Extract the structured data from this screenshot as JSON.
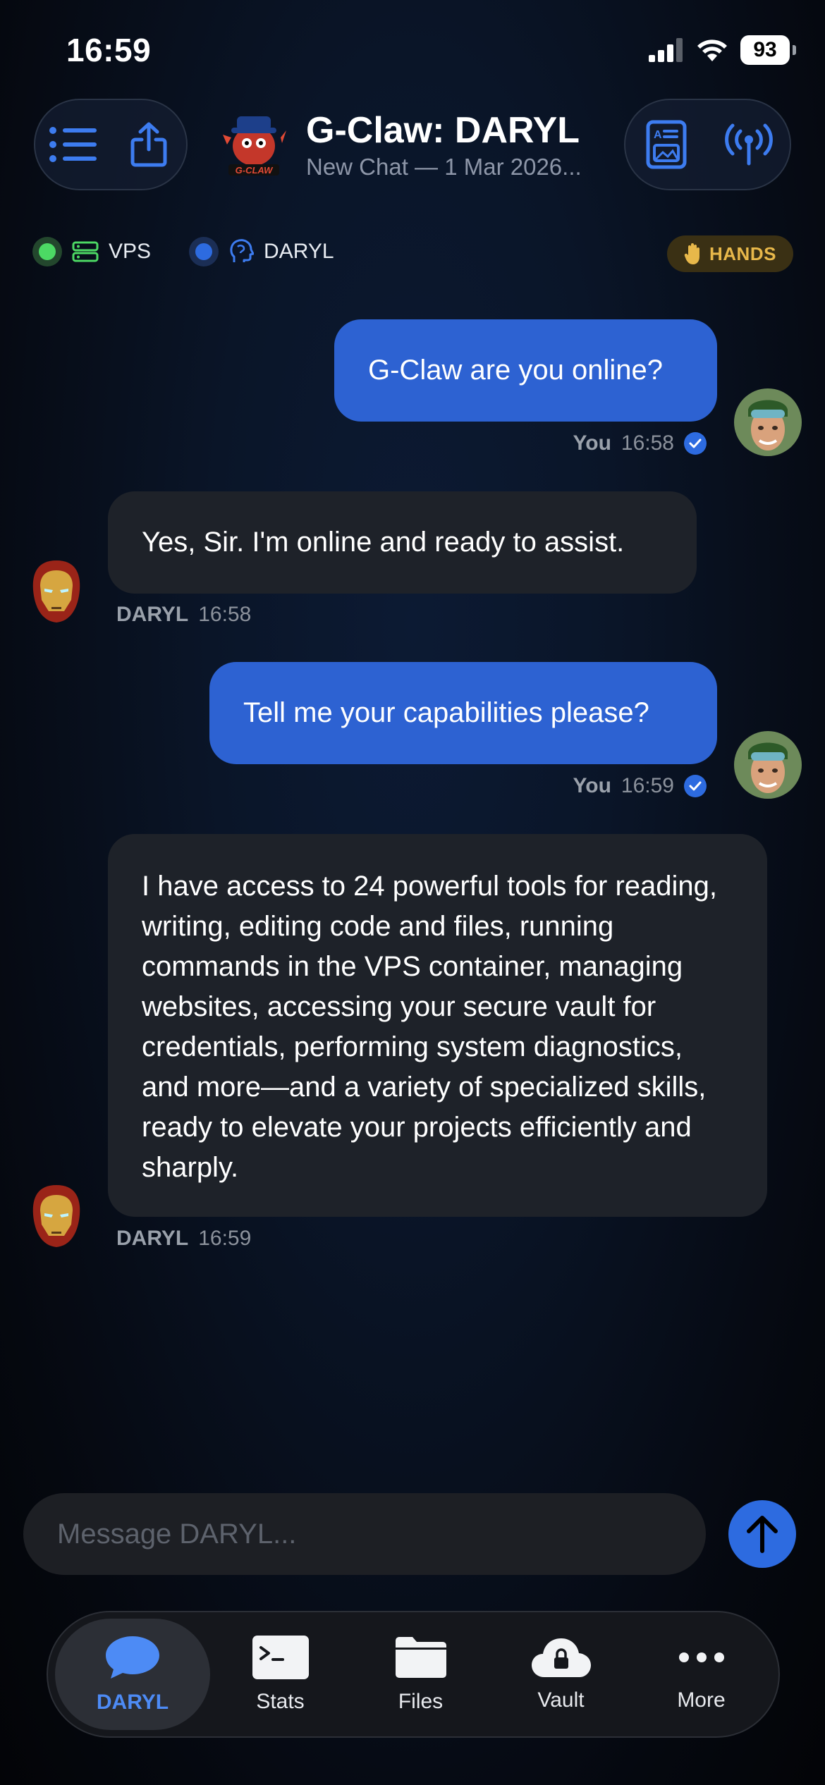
{
  "status_bar": {
    "time": "16:59",
    "battery": "93"
  },
  "header": {
    "title": "G-Claw: DARYL",
    "subtitle": "New Chat — 1 Mar 2026...",
    "logo_text": "G-CLAW"
  },
  "status_chips": [
    {
      "label": "VPS",
      "color": "#4cd964"
    },
    {
      "label": "DARYL",
      "color": "#2d6be0"
    }
  ],
  "hands_badge": "HANDS",
  "messages": [
    {
      "sender": "You",
      "time": "16:58",
      "text": "G-Claw are you online?"
    },
    {
      "sender": "DARYL",
      "time": "16:58",
      "text": "Yes, Sir. I'm online and ready to assist."
    },
    {
      "sender": "You",
      "time": "16:59",
      "text": "Tell me your capabilities please?"
    },
    {
      "sender": "DARYL",
      "time": "16:59",
      "text": "I have access to 24 powerful tools for reading, writing, editing code and files, running commands in the VPS container, managing websites, accessing your secure vault for credentials, performing system diagnostics, and more—and a variety of specialized skills, ready to elevate your projects efficiently and sharply."
    }
  ],
  "composer": {
    "placeholder": "Message DARYL..."
  },
  "tabs": [
    {
      "label": "DARYL",
      "icon": "chat-bubble-icon"
    },
    {
      "label": "Stats",
      "icon": "terminal-icon"
    },
    {
      "label": "Files",
      "icon": "folder-icon"
    },
    {
      "label": "Vault",
      "icon": "cloud-lock-icon"
    },
    {
      "label": "More",
      "icon": "ellipsis-icon"
    }
  ],
  "colors": {
    "accent": "#2d6be0",
    "user_bubble": "#2d62d2",
    "bot_bubble": "#1e2229",
    "hands": "#e8b84a"
  }
}
